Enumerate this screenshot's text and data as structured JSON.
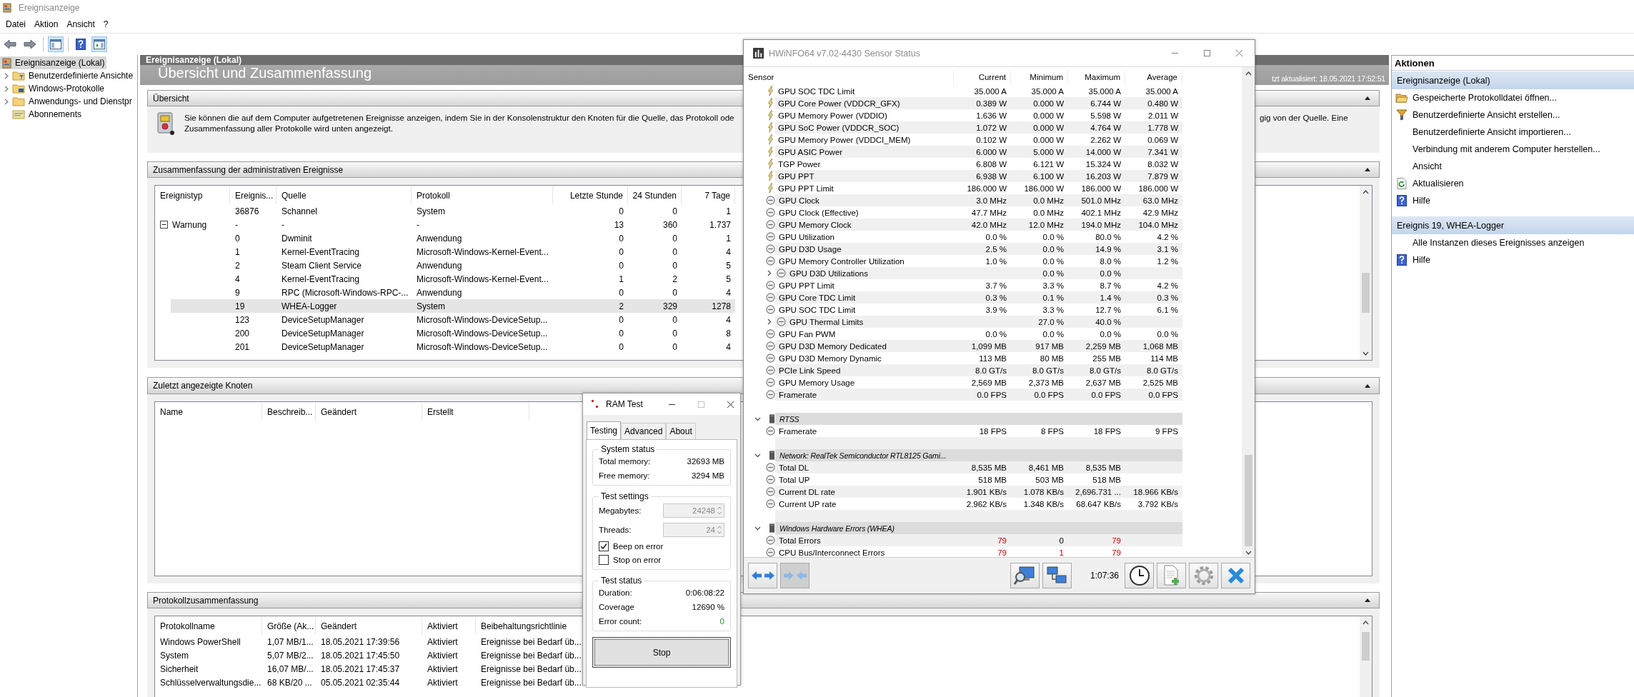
{
  "event_viewer": {
    "title": "Ereignisanzeige",
    "menu": [
      "Datei",
      "Aktion",
      "Ansicht",
      "?"
    ],
    "toolbar": [
      {
        "kind": "back",
        "pressed": false
      },
      {
        "kind": "forward",
        "pressed": false
      },
      {
        "kind": "tree",
        "pressed": true
      },
      {
        "kind": "help",
        "pressed": false
      },
      {
        "kind": "actions",
        "pressed": true
      }
    ],
    "tree": [
      {
        "label": "Ereignisanzeige (Lokal)",
        "selected": true,
        "children": [
          {
            "label": "Benutzerdefinierte Ansichte",
            "expandable": true,
            "selected": false
          },
          {
            "label": "Windows-Protokolle",
            "expandable": true,
            "selected": false
          },
          {
            "label": "Anwendungs- und Dienstpr",
            "expandable": true,
            "selected": false
          },
          {
            "label": "Abonnements",
            "expandable": false,
            "selected": false
          }
        ]
      }
    ],
    "center": {
      "header": "Ereignisanzeige (Lokal)",
      "heading": "Übersicht und Zusammenfassung",
      "updated": "tzt aktualisiert: 18.05.2021 17:52:51",
      "overview": {
        "title": "Übersicht",
        "lines": [
          "Sie können die auf dem Computer aufgetretenen Ereignisse anzeigen, indem Sie in der Konsolenstruktur den Knoten für die Quelle, das Protokoll ode",
          "Zusammenfassung aller Protokolle wird unten angezeigt."
        ],
        "continuation": "gig von der Quelle. Eine"
      },
      "admin": {
        "title": "Zusammenfassung der administrativen Ereignisse",
        "columns": [
          "Ereignistyp",
          "Ereignis...",
          "Quelle",
          "Protokoll",
          "Letzte Stunde",
          "24 Stunden",
          "7 Tage"
        ],
        "rows": [
          {
            "kind": "event",
            "cells": [
              "",
              "36876",
              "Schannel",
              "System",
              "0",
              "0",
              "1"
            ],
            "selected": false
          },
          {
            "kind": "group",
            "expanded": true,
            "cells": [
              "Warnung",
              "-",
              "-",
              "-",
              "13",
              "360",
              "1.737"
            ],
            "selected": false
          },
          {
            "kind": "event",
            "cells": [
              "",
              "0",
              "Dwminit",
              "Anwendung",
              "0",
              "0",
              "1"
            ],
            "selected": false
          },
          {
            "kind": "event",
            "cells": [
              "",
              "1",
              "Kernel-EventTracing",
              "Microsoft-Windows-Kernel-Event...",
              "0",
              "0",
              "4"
            ],
            "selected": false
          },
          {
            "kind": "event",
            "cells": [
              "",
              "2",
              "Steam Client Service",
              "Anwendung",
              "0",
              "0",
              "5"
            ],
            "selected": false
          },
          {
            "kind": "event",
            "cells": [
              "",
              "4",
              "Kernel-EventTracing",
              "Microsoft-Windows-Kernel-Event...",
              "1",
              "2",
              "5"
            ],
            "selected": false
          },
          {
            "kind": "event",
            "cells": [
              "",
              "9",
              "RPC (Microsoft-Windows-RPC-...",
              "Anwendung",
              "0",
              "0",
              "4"
            ],
            "selected": false
          },
          {
            "kind": "event",
            "cells": [
              "",
              "19",
              "WHEA-Logger",
              "System",
              "2",
              "329",
              "1278"
            ],
            "selected": true
          },
          {
            "kind": "event",
            "cells": [
              "",
              "123",
              "DeviceSetupManager",
              "Microsoft-Windows-DeviceSetup...",
              "0",
              "0",
              "4"
            ],
            "selected": false
          },
          {
            "kind": "event",
            "cells": [
              "",
              "200",
              "DeviceSetupManager",
              "Microsoft-Windows-DeviceSetup...",
              "0",
              "0",
              "8"
            ],
            "selected": false
          },
          {
            "kind": "event",
            "cells": [
              "",
              "201",
              "DeviceSetupManager",
              "Microsoft-Windows-DeviceSetup...",
              "0",
              "0",
              "4"
            ],
            "selected": false
          }
        ]
      },
      "recent": {
        "title": "Zuletzt angezeigte Knoten",
        "columns": [
          "Name",
          "Beschreib...",
          "Geändert",
          "Erstellt"
        ]
      },
      "logs": {
        "title": "Protokollzusammenfassung",
        "columns": [
          "Protokollname",
          "Größe (Ak...",
          "Geändert",
          "Aktiviert",
          "Beibehaltungsrichtlinie"
        ],
        "rows": [
          [
            "Windows PowerShell",
            "1,07 MB/1...",
            "18.05.2021 17:39:56",
            "Aktiviert",
            "Ereignisse bei Bedarf üb..."
          ],
          [
            "System",
            "5,07 MB/2...",
            "18.05.2021 17:45:50",
            "Aktiviert",
            "Ereignisse bei Bedarf üb..."
          ],
          [
            "Sicherheit",
            "16,07 MB/...",
            "18.05.2021 17:45:37",
            "Aktiviert",
            "Ereignisse bei Bedarf üb..."
          ],
          [
            "Schlüsselverwaltungsdie...",
            "68 KB/20 ...",
            "05.05.2021 02:35:44",
            "Aktiviert",
            "Ereignisse bei Bedarf üb..."
          ]
        ]
      }
    },
    "actions": {
      "title": "Aktionen",
      "sections": [
        {
          "title": "Ereignisanzeige (Lokal)",
          "items": [
            {
              "label": "Gespeicherte Protokolldatei öffnen..."
            },
            {
              "label": "Benutzerdefinierte Ansicht erstellen..."
            },
            {
              "label": "Benutzerdefinierte Ansicht importieren..."
            },
            {
              "label": "Verbindung mit anderem Computer herstellen..."
            },
            {
              "label": "Ansicht"
            },
            {
              "label": "Aktualisieren"
            },
            {
              "label": "Hilfe"
            }
          ]
        },
        {
          "title": "Ereignis 19, WHEA-Logger",
          "items": [
            {
              "label": "Alle Instanzen dieses Ereignisses anzeigen"
            },
            {
              "label": "Hilfe"
            }
          ]
        }
      ]
    }
  },
  "hwinfo": {
    "title": "HWiNFO64 v7.02-4430 Sensor Status",
    "columns": [
      "Sensor",
      "Current",
      "Minimum",
      "Maximum",
      "Average"
    ],
    "rows": [
      {
        "kind": "power",
        "name": "GPU SOC TDC Limit",
        "values": {
          "current": "35.000 A",
          "minimum": "35.000 A",
          "maximum": "35.000 A",
          "average": "35.000 A"
        }
      },
      {
        "kind": "power",
        "name": "GPU Core Power (VDDCR_GFX)",
        "values": {
          "current": "0.389 W",
          "minimum": "0.000 W",
          "maximum": "6.744 W",
          "average": "0.480 W"
        }
      },
      {
        "kind": "power",
        "name": "GPU Memory Power (VDDIO)",
        "values": {
          "current": "1.636 W",
          "minimum": "0.000 W",
          "maximum": "5.598 W",
          "average": "2.011 W"
        }
      },
      {
        "kind": "power",
        "name": "GPU SoC Power (VDDCR_SOC)",
        "values": {
          "current": "1.072 W",
          "minimum": "0.000 W",
          "maximum": "4.764 W",
          "average": "1.778 W"
        }
      },
      {
        "kind": "power",
        "name": "GPU Memory Power (VDDCI_MEM)",
        "values": {
          "current": "0.102 W",
          "minimum": "0.000 W",
          "maximum": "2.262 W",
          "average": "0.069 W"
        }
      },
      {
        "kind": "power",
        "name": "GPU ASIC Power",
        "values": {
          "current": "6.000 W",
          "minimum": "5.000 W",
          "maximum": "14.000 W",
          "average": "7.341 W"
        }
      },
      {
        "kind": "power",
        "name": "TGP Power",
        "values": {
          "current": "6.808 W",
          "minimum": "6.121 W",
          "maximum": "15.324 W",
          "average": "8.032 W"
        }
      },
      {
        "kind": "power",
        "name": "GPU PPT",
        "values": {
          "current": "6.938 W",
          "minimum": "6.100 W",
          "maximum": "16.203 W",
          "average": "7.879 W"
        }
      },
      {
        "kind": "power",
        "name": "GPU PPT Limit",
        "values": {
          "current": "186.000 W",
          "minimum": "186.000 W",
          "maximum": "186.000 W",
          "average": "186.000 W"
        }
      },
      {
        "kind": "gauge",
        "name": "GPU Clock",
        "values": {
          "current": "3.0 MHz",
          "minimum": "0.0 MHz",
          "maximum": "501.0 MHz",
          "average": "63.0 MHz"
        }
      },
      {
        "kind": "gauge",
        "name": "GPU Clock (Effective)",
        "values": {
          "current": "47.7 MHz",
          "minimum": "0.0 MHz",
          "maximum": "402.1 MHz",
          "average": "42.9 MHz"
        }
      },
      {
        "kind": "gauge",
        "name": "GPU Memory Clock",
        "values": {
          "current": "42.0 MHz",
          "minimum": "12.0 MHz",
          "maximum": "194.0 MHz",
          "average": "104.0 MHz"
        }
      },
      {
        "kind": "gauge",
        "name": "GPU Utilization",
        "values": {
          "current": "0.0 %",
          "minimum": "0.0 %",
          "maximum": "80.0 %",
          "average": "4.2 %"
        }
      },
      {
        "kind": "gauge",
        "name": "GPU D3D Usage",
        "values": {
          "current": "2.5 %",
          "minimum": "0.0 %",
          "maximum": "14.9 %",
          "average": "3.1 %"
        }
      },
      {
        "kind": "gauge",
        "name": "GPU Memory Controller Utilization",
        "values": {
          "current": "1.0 %",
          "minimum": "0.0 %",
          "maximum": "8.0 %",
          "average": "1.2 %"
        }
      },
      {
        "kind": "group",
        "name": "GPU D3D Utilizations",
        "expanded": false,
        "values": {
          "minimum": "0.0 %",
          "maximum": "0.0 %"
        }
      },
      {
        "kind": "gauge",
        "name": "GPU PPT Limit",
        "values": {
          "current": "3.7 %",
          "minimum": "3.3 %",
          "maximum": "8.7 %",
          "average": "4.2 %"
        }
      },
      {
        "kind": "gauge",
        "name": "GPU Core TDC Limit",
        "values": {
          "current": "0.3 %",
          "minimum": "0.1 %",
          "maximum": "1.4 %",
          "average": "0.3 %"
        }
      },
      {
        "kind": "gauge",
        "name": "GPU SOC TDC Limit",
        "values": {
          "current": "3.9 %",
          "minimum": "3.3 %",
          "maximum": "12.7 %",
          "average": "6.1 %"
        }
      },
      {
        "kind": "group",
        "name": "GPU Thermal Limits",
        "expanded": false,
        "values": {
          "minimum": "27.0 %",
          "maximum": "40.0 %"
        }
      },
      {
        "kind": "gauge",
        "name": "GPU Fan PWM",
        "values": {
          "current": "0.0 %",
          "minimum": "0.0 %",
          "maximum": "0.0 %",
          "average": "0.0 %"
        }
      },
      {
        "kind": "gauge",
        "name": "GPU D3D Memory Dedicated",
        "values": {
          "current": "1,099 MB",
          "minimum": "917 MB",
          "maximum": "2,259 MB",
          "average": "1,068 MB"
        }
      },
      {
        "kind": "gauge",
        "name": "GPU D3D Memory Dynamic",
        "values": {
          "current": "113 MB",
          "minimum": "80 MB",
          "maximum": "255 MB",
          "average": "114 MB"
        }
      },
      {
        "kind": "gauge",
        "name": "PCIe Link Speed",
        "values": {
          "current": "8.0 GT/s",
          "minimum": "8.0 GT/s",
          "maximum": "8.0 GT/s",
          "average": "8.0 GT/s"
        }
      },
      {
        "kind": "gauge",
        "name": "GPU Memory Usage",
        "values": {
          "current": "2,569 MB",
          "minimum": "2,373 MB",
          "maximum": "2,637 MB",
          "average": "2,525 MB"
        }
      },
      {
        "kind": "gauge",
        "name": "Framerate",
        "values": {
          "current": "0.0 FPS",
          "minimum": "0.0 FPS",
          "maximum": "0.0 FPS",
          "average": "0.0 FPS"
        }
      },
      {
        "kind": "spacer"
      },
      {
        "kind": "header",
        "name": "RTSS",
        "expanded": true
      },
      {
        "kind": "gauge",
        "name": "Framerate",
        "values": {
          "current": "18 FPS",
          "minimum": "8 FPS",
          "maximum": "18 FPS",
          "average": "9 FPS"
        }
      },
      {
        "kind": "spacer"
      },
      {
        "kind": "header",
        "name": "Network: RealTek Semiconductor RTL8125 Gami...",
        "expanded": true
      },
      {
        "kind": "gauge",
        "name": "Total DL",
        "values": {
          "current": "8,535 MB",
          "minimum": "8,461 MB",
          "maximum": "8,535 MB"
        }
      },
      {
        "kind": "gauge",
        "name": "Total UP",
        "values": {
          "current": "518 MB",
          "minimum": "503 MB",
          "maximum": "518 MB"
        }
      },
      {
        "kind": "gauge",
        "name": "Current DL rate",
        "values": {
          "current": "1.901 KB/s",
          "minimum": "1.078 KB/s",
          "maximum": "2,696.731 ...",
          "average": "18.966 KB/s"
        }
      },
      {
        "kind": "gauge",
        "name": "Current UP rate",
        "values": {
          "current": "2.962 KB/s",
          "minimum": "1.348 KB/s",
          "maximum": "68.647 KB/s",
          "average": "3.792 KB/s"
        }
      },
      {
        "kind": "spacer"
      },
      {
        "kind": "header",
        "name": "Windows Hardware Errors (WHEA)",
        "expanded": true
      },
      {
        "kind": "gauge",
        "name": "Total Errors",
        "values": {
          "current": "79",
          "minimum": "0",
          "maximum": "79"
        },
        "alerts": {
          "current": true,
          "minimum": false,
          "maximum": true
        }
      },
      {
        "kind": "gauge",
        "name": "CPU Bus/Interconnect Errors",
        "values": {
          "current": "79",
          "minimum": "1",
          "maximum": "79"
        },
        "alerts": {
          "current": true,
          "minimum": true,
          "maximum": true
        }
      }
    ],
    "timer": "1:07:36"
  },
  "ram_test": {
    "title": "RAM Test",
    "tabs": [
      {
        "label": "Testing",
        "selected": true
      },
      {
        "label": "Advanced",
        "selected": false
      },
      {
        "label": "About",
        "selected": false
      }
    ],
    "system": {
      "title": "System status",
      "rows": [
        {
          "label": "Total memory:",
          "value": "32693 MB"
        },
        {
          "label": "Free memory:",
          "value": "3294 MB"
        }
      ]
    },
    "settings": {
      "title": "Test settings",
      "fields": [
        {
          "label": "Megabytes:",
          "value": "24248",
          "disabled": true
        },
        {
          "label": "Threads:",
          "value": "24",
          "disabled": true
        }
      ],
      "checks": [
        {
          "label": "Beep on error",
          "checked": true
        },
        {
          "label": "Stop on error",
          "checked": false
        }
      ]
    },
    "status": {
      "title": "Test status",
      "rows": [
        {
          "label": "Duration:",
          "value": "0:06:08:22",
          "good": false
        },
        {
          "label": "Coverage",
          "value": "12690 %",
          "good": false
        },
        {
          "label": "Error count:",
          "value": "0",
          "good": true
        }
      ]
    },
    "button": "Stop"
  }
}
